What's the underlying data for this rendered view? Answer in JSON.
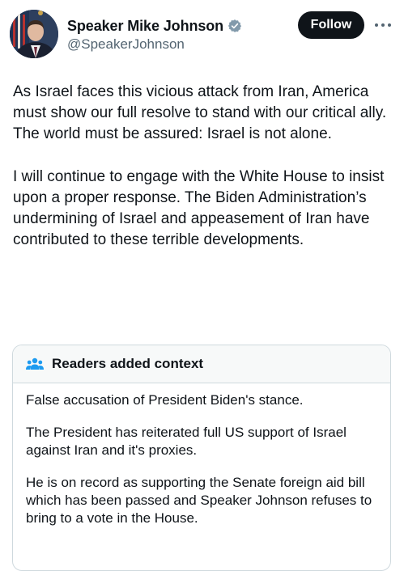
{
  "author": {
    "display_name": "Speaker Mike Johnson",
    "handle": "@SpeakerJohnson",
    "avatar_icon": "portrait-with-flag",
    "verified_icon": "gray-verified-badge-icon",
    "verified_color": "#829aab"
  },
  "actions": {
    "follow_label": "Follow",
    "more_icon": "more-horizontal-icon"
  },
  "tweet": {
    "paragraphs": [
      "As Israel faces this vicious attack from Iran, America must show our full resolve to stand with our critical ally. The world must be assured: Israel is not alone.",
      "I will continue to engage with the White House to insist upon a proper response. The Biden Administration’s undermining of Israel and appeasement of Iran have contributed to these terrible developments."
    ]
  },
  "community_note": {
    "icon": "readers-people-icon",
    "icon_color": "#1d9bf0",
    "title": "Readers added context",
    "paragraphs": [
      "False accusation of President Biden's stance.",
      "The President has reiterated full US support of Israel against Iran and it's proxies.",
      "He is on record as supporting the Senate foreign aid bill which has been passed and Speaker Johnson refuses to bring to a vote in the House."
    ]
  }
}
